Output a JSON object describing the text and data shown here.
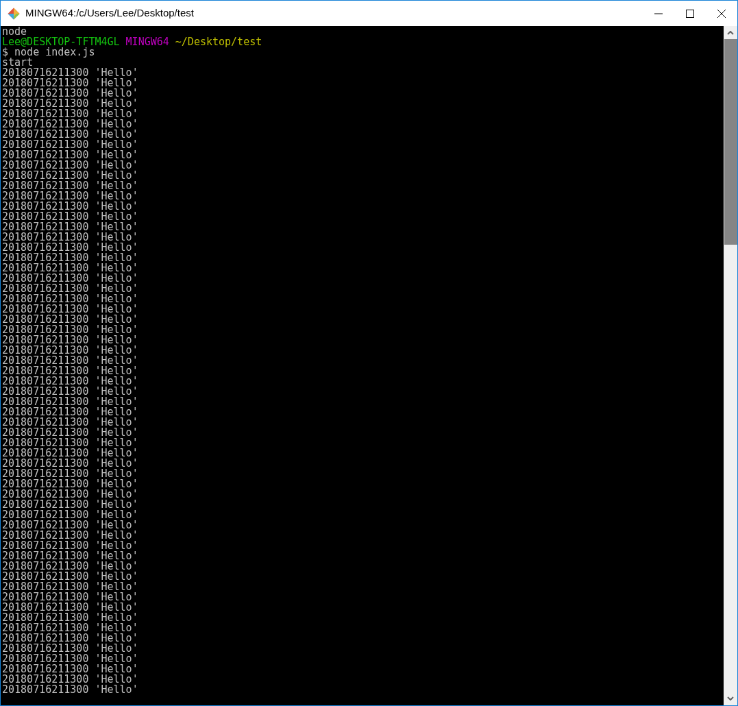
{
  "window": {
    "title": "MINGW64:/c/Users/Lee/Desktop/test"
  },
  "terminal": {
    "lines": [
      {
        "kind": "plain",
        "text": "node"
      },
      {
        "kind": "prompt",
        "user": "Lee@DESKTOP-TFTM4GL",
        "system": "MINGW64",
        "path": "~/Desktop/test"
      },
      {
        "kind": "plain",
        "text": "$ node index.js"
      },
      {
        "kind": "plain",
        "text": "start"
      },
      {
        "kind": "plain",
        "text": "20180716211300 'Hello'"
      },
      {
        "kind": "plain",
        "text": "20180716211300 'Hello'"
      },
      {
        "kind": "plain",
        "text": "20180716211300 'Hello'"
      },
      {
        "kind": "plain",
        "text": "20180716211300 'Hello'"
      },
      {
        "kind": "plain",
        "text": "20180716211300 'Hello'"
      },
      {
        "kind": "plain",
        "text": "20180716211300 'Hello'"
      },
      {
        "kind": "plain",
        "text": "20180716211300 'Hello'"
      },
      {
        "kind": "plain",
        "text": "20180716211300 'Hello'"
      },
      {
        "kind": "plain",
        "text": "20180716211300 'Hello'"
      },
      {
        "kind": "plain",
        "text": "20180716211300 'Hello'"
      },
      {
        "kind": "plain",
        "text": "20180716211300 'Hello'"
      },
      {
        "kind": "plain",
        "text": "20180716211300 'Hello'"
      },
      {
        "kind": "plain",
        "text": "20180716211300 'Hello'"
      },
      {
        "kind": "plain",
        "text": "20180716211300 'Hello'"
      },
      {
        "kind": "plain",
        "text": "20180716211300 'Hello'"
      },
      {
        "kind": "plain",
        "text": "20180716211300 'Hello'"
      },
      {
        "kind": "plain",
        "text": "20180716211300 'Hello'"
      },
      {
        "kind": "plain",
        "text": "20180716211300 'Hello'"
      },
      {
        "kind": "plain",
        "text": "20180716211300 'Hello'"
      },
      {
        "kind": "plain",
        "text": "20180716211300 'Hello'"
      },
      {
        "kind": "plain",
        "text": "20180716211300 'Hello'"
      },
      {
        "kind": "plain",
        "text": "20180716211300 'Hello'"
      },
      {
        "kind": "plain",
        "text": "20180716211300 'Hello'"
      },
      {
        "kind": "plain",
        "text": "20180716211300 'Hello'"
      },
      {
        "kind": "plain",
        "text": "20180716211300 'Hello'"
      },
      {
        "kind": "plain",
        "text": "20180716211300 'Hello'"
      },
      {
        "kind": "plain",
        "text": "20180716211300 'Hello'"
      },
      {
        "kind": "plain",
        "text": "20180716211300 'Hello'"
      },
      {
        "kind": "plain",
        "text": "20180716211300 'Hello'"
      },
      {
        "kind": "plain",
        "text": "20180716211300 'Hello'"
      },
      {
        "kind": "plain",
        "text": "20180716211300 'Hello'"
      },
      {
        "kind": "plain",
        "text": "20180716211300 'Hello'"
      },
      {
        "kind": "plain",
        "text": "20180716211300 'Hello'"
      },
      {
        "kind": "plain",
        "text": "20180716211300 'Hello'"
      },
      {
        "kind": "plain",
        "text": "20180716211300 'Hello'"
      },
      {
        "kind": "plain",
        "text": "20180716211300 'Hello'"
      },
      {
        "kind": "plain",
        "text": "20180716211300 'Hello'"
      },
      {
        "kind": "plain",
        "text": "20180716211300 'Hello'"
      },
      {
        "kind": "plain",
        "text": "20180716211300 'Hello'"
      },
      {
        "kind": "plain",
        "text": "20180716211300 'Hello'"
      },
      {
        "kind": "plain",
        "text": "20180716211300 'Hello'"
      },
      {
        "kind": "plain",
        "text": "20180716211300 'Hello'"
      },
      {
        "kind": "plain",
        "text": "20180716211300 'Hello'"
      },
      {
        "kind": "plain",
        "text": "20180716211300 'Hello'"
      },
      {
        "kind": "plain",
        "text": "20180716211300 'Hello'"
      },
      {
        "kind": "plain",
        "text": "20180716211300 'Hello'"
      },
      {
        "kind": "plain",
        "text": "20180716211300 'Hello'"
      },
      {
        "kind": "plain",
        "text": "20180716211300 'Hello'"
      },
      {
        "kind": "plain",
        "text": "20180716211300 'Hello'"
      },
      {
        "kind": "plain",
        "text": "20180716211300 'Hello'"
      },
      {
        "kind": "plain",
        "text": "20180716211300 'Hello'"
      },
      {
        "kind": "plain",
        "text": "20180716211300 'Hello'"
      },
      {
        "kind": "plain",
        "text": "20180716211300 'Hello'"
      },
      {
        "kind": "plain",
        "text": "20180716211300 'Hello'"
      },
      {
        "kind": "plain",
        "text": "20180716211300 'Hello'"
      },
      {
        "kind": "plain",
        "text": "20180716211300 'Hello'"
      },
      {
        "kind": "plain",
        "text": "20180716211300 'Hello'"
      },
      {
        "kind": "plain",
        "text": "20180716211300 'Hello'"
      },
      {
        "kind": "plain",
        "text": "20180716211300 'Hello'"
      },
      {
        "kind": "plain",
        "text": "20180716211300 'Hello'"
      },
      {
        "kind": "plain",
        "text": "20180716211300 'Hello'"
      }
    ]
  }
}
